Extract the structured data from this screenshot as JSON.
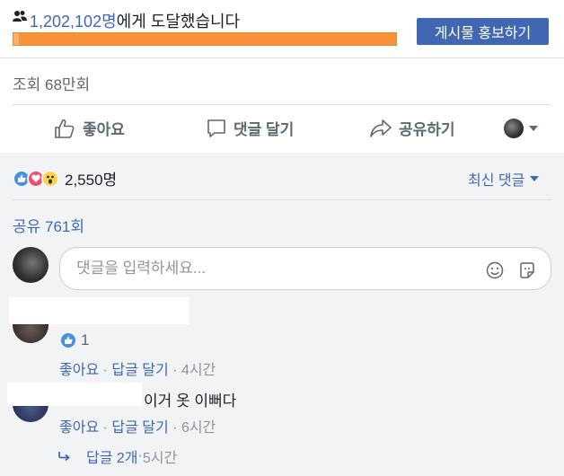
{
  "reach": {
    "count": "1,202,102명",
    "suffix": "에게 도달했습니다",
    "progress_fraction": 1.0,
    "promote_button": "게시물 홍보하기"
  },
  "views": "조회 68만회",
  "actions": {
    "like": "좋아요",
    "comment": "댓글 달기",
    "share": "공유하기"
  },
  "reactions": {
    "icons": [
      "like-icon",
      "love-icon",
      "wow-icon"
    ],
    "count": "2,550명"
  },
  "sort_label": "최신 댓글",
  "shares": "공유 761회",
  "comment_input": {
    "placeholder": "댓글을 입력하세요..."
  },
  "comments": [
    {
      "text": "",
      "likes": "1",
      "like_label": "좋아요",
      "reply_label": "답글 달기",
      "time": "4시간"
    },
    {
      "text": "이거 옷 이뻐다",
      "like_label": "좋아요",
      "reply_label": "답글 달기",
      "time": "6시간"
    }
  ],
  "replies": {
    "label": "답글 2개",
    "time": "5시간"
  },
  "colors": {
    "brand": "#4267b2",
    "progress": "#f7923a",
    "muted": "#606770",
    "comments_bg": "#f2f3f5"
  }
}
